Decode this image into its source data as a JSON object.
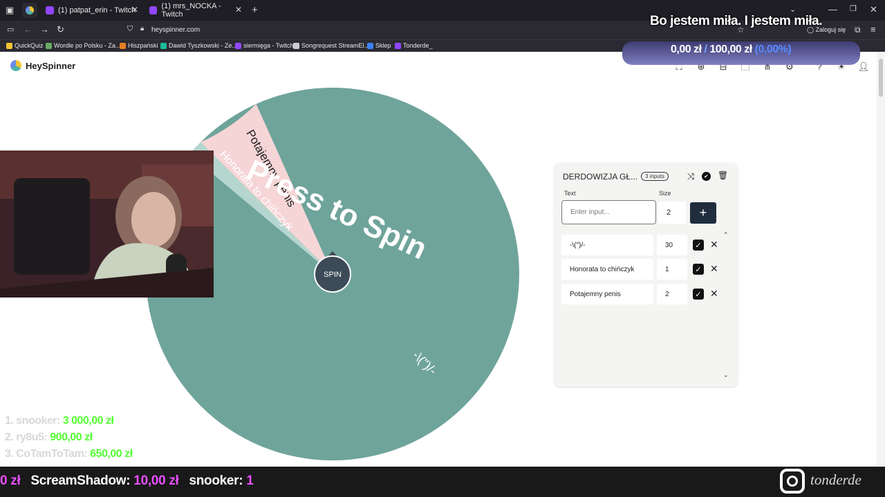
{
  "browser": {
    "tabs": [
      {
        "label": "(1) patpat_erin - Twitch"
      },
      {
        "label": "(1) mrs_NOCKA - Twitch"
      }
    ],
    "new_tab": "+",
    "url": "heyspinner.com",
    "login": "Zaloguj się",
    "bookmarks": [
      {
        "label": "QuickQuiz",
        "color": "#f4c430"
      },
      {
        "label": "Wordle po Polsku - Za...",
        "color": "#6aaa64"
      },
      {
        "label": "Hiszpański",
        "color": "#e67e22"
      },
      {
        "label": "Dawid Tyszkowski - Ze...",
        "color": "#1abc9c"
      },
      {
        "label": "siermięga - Twitch",
        "color": "#9146ff"
      },
      {
        "label": "Songrequest StreamEl...",
        "color": "#cccccc"
      },
      {
        "label": "Sklep",
        "color": "#3b82f6"
      },
      {
        "label": "Tonderde_",
        "color": "#9146ff"
      }
    ]
  },
  "app": {
    "name": "HeySpinner"
  },
  "wheel": {
    "press_text": "Press to Spin",
    "spin_label": "SPIN",
    "colors": {
      "large": "#6fa49b",
      "pink": "#f6d5d7",
      "light": "#b5d6cf"
    },
    "segments": [
      {
        "label": "-\\(\")/-"
      },
      {
        "label": "Honorata to chińczyk"
      },
      {
        "label": "Potajemny penis"
      }
    ]
  },
  "panel": {
    "title": "DERDOWIZJA GŁ...",
    "badge": "3 inputs",
    "text_label": "Text",
    "size_label": "Size",
    "input_placeholder": "Enter input...",
    "input_size": "2",
    "add_label": "+",
    "entries": [
      {
        "text": "-\\(\")/-",
        "size": "30"
      },
      {
        "text": "Honorata to chińczyk",
        "size": "1"
      },
      {
        "text": "Potajemny penis",
        "size": "2"
      }
    ]
  },
  "overlay": {
    "top_text": "Bo jestem miła. I jestem miła.",
    "donation_current": "0,00 zł",
    "donation_sep": " / ",
    "donation_goal": "100,00 zł",
    "donation_pct": "(0,00%)",
    "leaderboard": [
      {
        "name": "1. snooker:",
        "amount": "3 000,00 zł"
      },
      {
        "name": "2. ry8u5:",
        "amount": "900,00 zł"
      },
      {
        "name": "3. CoTamToTam:",
        "amount": "650,00 zł"
      }
    ],
    "ticker": {
      "lead": "0 zł",
      "item1_name": "ScreamShadow:",
      "item1_amount": "10,00 zł",
      "item2_name": "snooker:",
      "item2_amount": "1"
    },
    "instagram_handle": "tonderde"
  }
}
